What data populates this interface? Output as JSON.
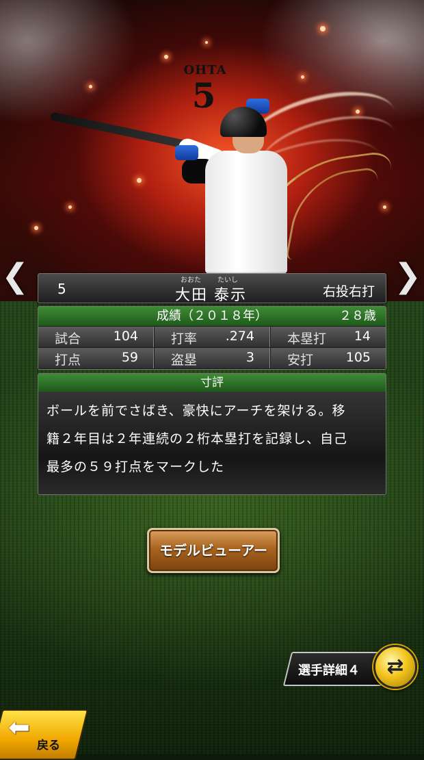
{
  "player": {
    "number": "5",
    "reading_family": "おおた",
    "reading_given": "たいし",
    "name": "大田 泰示",
    "throw_bat": "右投右打",
    "jersey_name": "OHTA",
    "jersey_number": "5"
  },
  "nav": {
    "prev_glyph": "❮",
    "next_glyph": "❯"
  },
  "stats": {
    "title": "成績（２０１８年）",
    "age": "２８歳",
    "rows": [
      [
        {
          "label": "試合",
          "value": "104"
        },
        {
          "label": "打率",
          "value": ".274"
        },
        {
          "label": "本塁打",
          "value": "14"
        }
      ],
      [
        {
          "label": "打点",
          "value": "59"
        },
        {
          "label": "盗塁",
          "value": "3"
        },
        {
          "label": "安打",
          "value": "105"
        }
      ]
    ]
  },
  "review": {
    "title": "寸評",
    "lines": [
      "ボールを前でさばき、豪快にアーチを架ける。移",
      "籍２年目は２年連続の２桁本塁打を記録し、自己",
      "最多の５９打点をマークした"
    ]
  },
  "buttons": {
    "model_viewer": "モデルビューアー",
    "detail": "選手詳細４",
    "swap_icon": "swap-arrows-icon",
    "back": "戻る"
  },
  "colors": {
    "accent_green": "#2e7a28",
    "button_brown": "#a9641e",
    "gold": "#f3c41c"
  }
}
